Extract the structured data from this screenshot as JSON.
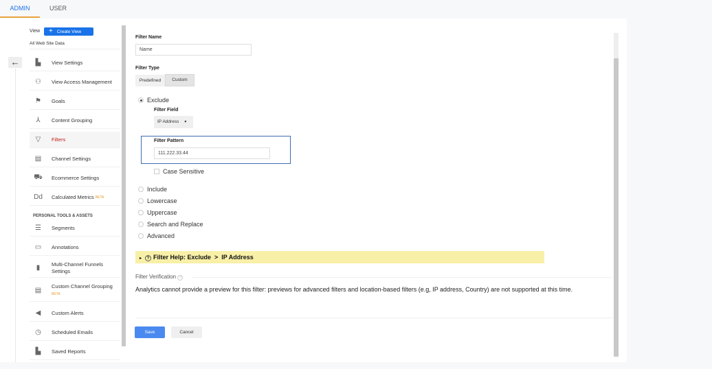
{
  "tabs": [
    {
      "label": "ADMIN"
    },
    {
      "label": "USER"
    }
  ],
  "sidebar": {
    "view_label": "View",
    "create_view": "Create View",
    "view_name": "All Web Site Data",
    "items": [
      {
        "label": "View Settings",
        "icon": "document-icon"
      },
      {
        "label": "View Access Management",
        "icon": "people-icon"
      },
      {
        "label": "Goals",
        "icon": "flag-icon"
      },
      {
        "label": "Content Grouping",
        "icon": "person-icon"
      },
      {
        "label": "Filters",
        "icon": "filter-icon",
        "active": true
      },
      {
        "label": "Channel Settings",
        "icon": "channel-icon"
      },
      {
        "label": "Ecommerce Settings",
        "icon": "cart-icon"
      },
      {
        "label": "Calculated Metrics",
        "badge": "BETA",
        "icon": "dd-icon"
      }
    ],
    "section": "PERSONAL TOOLS & ASSETS",
    "tools": [
      {
        "label": "Segments",
        "icon": "segments-icon"
      },
      {
        "label": "Annotations",
        "icon": "comment-icon"
      },
      {
        "label": "Multi-Channel Funnels",
        "label2": "Settings",
        "icon": "bar-chart-icon"
      },
      {
        "label": "Custom Channel Grouping",
        "badge": "BETA",
        "icon": "channel-icon"
      },
      {
        "label": "Custom Alerts",
        "icon": "megaphone-icon"
      },
      {
        "label": "Scheduled Emails",
        "icon": "clock-icon"
      },
      {
        "label": "Saved Reports",
        "icon": "document-icon"
      }
    ]
  },
  "form": {
    "filter_name_label": "Filter Name",
    "filter_name_value": "Name",
    "filter_type_label": "Filter Type",
    "type_tabs": [
      "Predefined",
      "Custom"
    ],
    "options": [
      "Exclude",
      "Include",
      "Lowercase",
      "Uppercase",
      "Search and Replace",
      "Advanced"
    ],
    "filter_field_label": "Filter Field",
    "filter_field_value": "IP Address",
    "filter_pattern_label": "Filter Pattern",
    "filter_pattern_value": "111.222.33.44",
    "case_sensitive": "Case Sensitive",
    "help": "Filter Help: Exclude  >  IP Address",
    "verification_label": "Filter Verification",
    "verification_text": "Analytics cannot provide a preview for this filter: previews for advanced filters and location-based filters (e.g, IP address, Country) are not supported at this time.",
    "save": "Save",
    "cancel": "Cancel"
  },
  "colors": {
    "accent": "#1a73e8",
    "active": "#c5221f",
    "help_bg": "#f9f0a8",
    "pattern_border": "#3b6db3"
  }
}
